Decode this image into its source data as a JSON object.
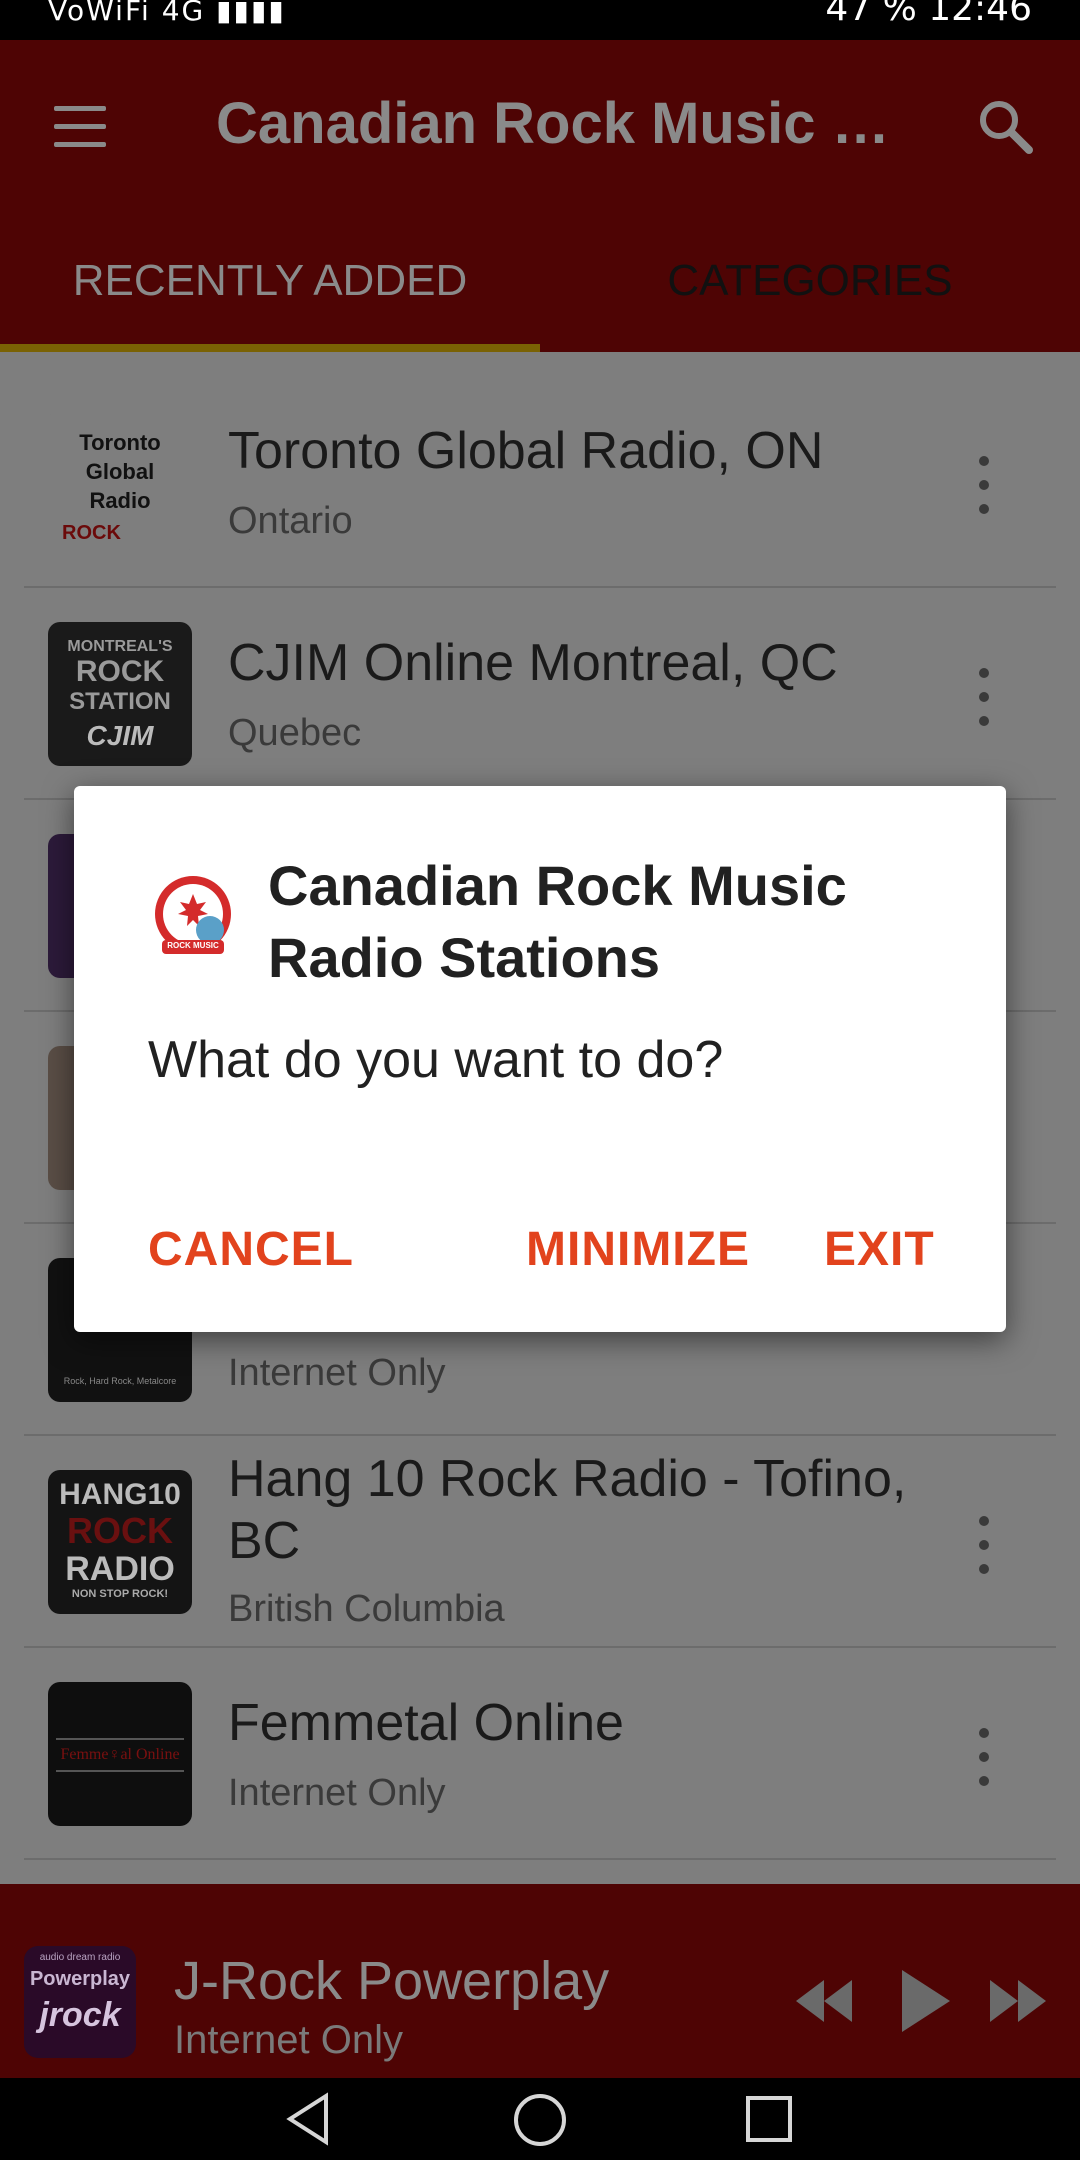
{
  "status_bar": {
    "left_text": "VoWiFi 4G ▮▮▮▮",
    "right_text": "47 %  12:46"
  },
  "app_bar": {
    "title": "Canadian Rock Music R..."
  },
  "tabs": [
    {
      "label": "RECENTLY ADDED",
      "active": true
    },
    {
      "label": "CATEGORIES",
      "active": false
    }
  ],
  "stations": [
    {
      "title": "Toronto Global Radio, ON",
      "subtitle": "Ontario",
      "thumb_text": [
        "Toronto",
        "Global",
        "Radio"
      ],
      "thumb_tag": "ROCK"
    },
    {
      "title": "CJIM Online Montreal, QC",
      "subtitle": "Quebec",
      "thumb_text": [
        "MONTREAL'S",
        "ROCK",
        "STATION"
      ],
      "thumb_tag": "CJIM"
    },
    {
      "title": "",
      "subtitle": "Internet Only",
      "thumb_caption": "Rock, Hard Rock, Metalcore"
    },
    {
      "title": "Hang 10 Rock Radio - Tofino, BC",
      "subtitle": "British Columbia",
      "thumb_text": [
        "HANG10",
        "ROCK",
        "RADIO"
      ],
      "thumb_tag": "NON STOP ROCK!"
    },
    {
      "title": "Femmetal Online",
      "subtitle": "Internet Only",
      "thumb_text": [
        "Femme♀al Online"
      ]
    }
  ],
  "player": {
    "title": "J-Rock Powerplay",
    "subtitle": "Internet Only",
    "thumb_text": [
      "audio dream radio",
      "Powerplay",
      "jrock"
    ]
  },
  "dialog": {
    "title": "Canadian Rock Music Radio Stations",
    "message": "What do you want to do?",
    "cancel_label": "CANCEL",
    "minimize_label": "MINIMIZE",
    "exit_label": "EXIT",
    "icon_caption": "ROCK MUSIC"
  },
  "colors": {
    "accent": "#e2431d",
    "appbar": "#4e0404",
    "dim": "#7e7e7e"
  }
}
